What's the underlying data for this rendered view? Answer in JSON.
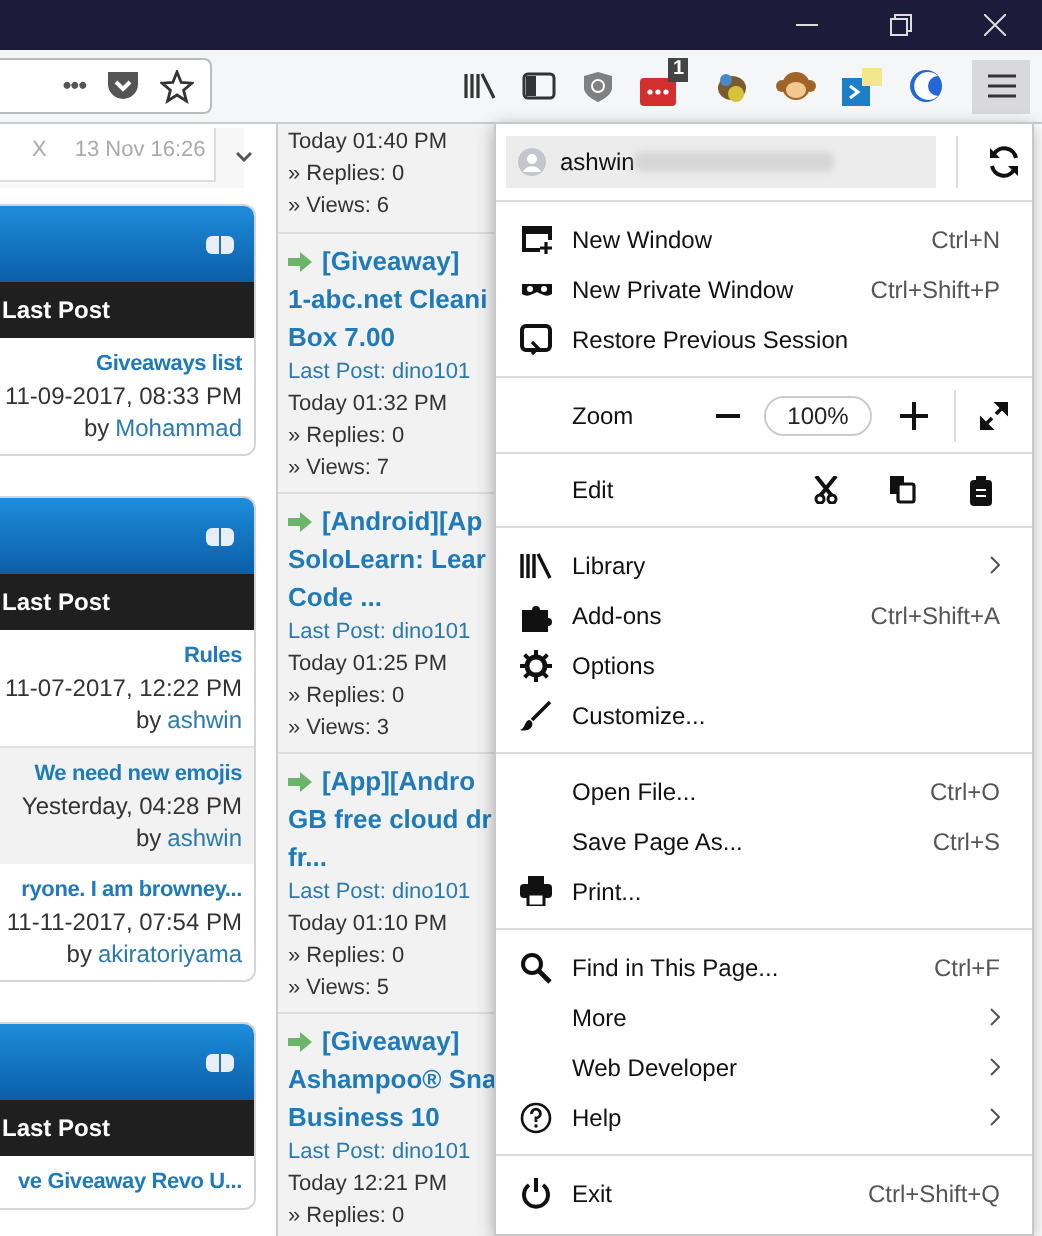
{
  "toolbar": {
    "url_actions": "•••",
    "extension_badge": "1"
  },
  "shoutbox": {
    "close": "X",
    "time": "13 Nov 16:26"
  },
  "forum_blocks": [
    {
      "header": "Last Post",
      "rows": [
        {
          "title": "Giveaways list",
          "date": "11-09-2017, 08:33 PM",
          "by": "by",
          "author": "Mohammad"
        }
      ]
    },
    {
      "header": "Last Post",
      "rows": [
        {
          "title": "Rules",
          "date": "11-07-2017, 12:22 PM",
          "by": "by",
          "author": "ashwin"
        },
        {
          "title": "We need new emojis",
          "date": "Yesterday, 04:28 PM",
          "by": "by",
          "author": "ashwin"
        },
        {
          "title": "ryone. I am browney...",
          "date": "11-11-2017, 07:54 PM",
          "by": "by",
          "author": "akiratoriyama"
        }
      ]
    },
    {
      "header": "Last Post",
      "rows": [
        {
          "title": "ve Giveaway Revo U..."
        }
      ]
    }
  ],
  "latest_threads": [
    {
      "time": "Today 01:40 PM",
      "replies": "» Replies: 0",
      "views": "» Views: 6"
    },
    {
      "title_lines": [
        "[Giveaway]",
        "1-abc.net Cleani",
        "Box 7.00"
      ],
      "last_post": "Last Post: dino101",
      "time": "Today 01:32 PM",
      "replies": "» Replies: 0",
      "views": "» Views: 7"
    },
    {
      "title_lines": [
        "[Android][Ap",
        "SoloLearn: Lear",
        "Code ..."
      ],
      "last_post": "Last Post: dino101",
      "time": "Today 01:25 PM",
      "replies": "» Replies: 0",
      "views": "» Views: 3"
    },
    {
      "title_lines": [
        "[App][Andro",
        "GB free cloud dr",
        "fr..."
      ],
      "last_post": "Last Post: dino101",
      "time": "Today 01:10 PM",
      "replies": "» Replies: 0",
      "views": "» Views: 5"
    },
    {
      "title_lines": [
        "[Giveaway]",
        "Ashampoo® Sna",
        "Business 10"
      ],
      "last_post": "Last Post: dino101",
      "time": "Today 12:21 PM",
      "replies": "» Replies: 0"
    }
  ],
  "menu": {
    "account": "ashwin",
    "zoom": {
      "label": "Zoom",
      "value": "100%"
    },
    "edit": {
      "label": "Edit"
    },
    "sections": [
      [
        {
          "label": "New Window",
          "shortcut": "Ctrl+N"
        },
        {
          "label": "New Private Window",
          "shortcut": "Ctrl+Shift+P"
        },
        {
          "label": "Restore Previous Session"
        }
      ],
      [
        {
          "label": "Library",
          "submenu": true
        },
        {
          "label": "Add-ons",
          "shortcut": "Ctrl+Shift+A"
        },
        {
          "label": "Options"
        },
        {
          "label": "Customize..."
        }
      ],
      [
        {
          "label": "Open File...",
          "shortcut": "Ctrl+O"
        },
        {
          "label": "Save Page As...",
          "shortcut": "Ctrl+S"
        },
        {
          "label": "Print..."
        }
      ],
      [
        {
          "label": "Find in This Page...",
          "shortcut": "Ctrl+F"
        },
        {
          "label": "More",
          "submenu": true
        },
        {
          "label": "Web Developer",
          "submenu": true
        },
        {
          "label": "Help",
          "submenu": true
        }
      ],
      [
        {
          "label": "Exit",
          "shortcut": "Ctrl+Shift+Q"
        }
      ]
    ]
  }
}
